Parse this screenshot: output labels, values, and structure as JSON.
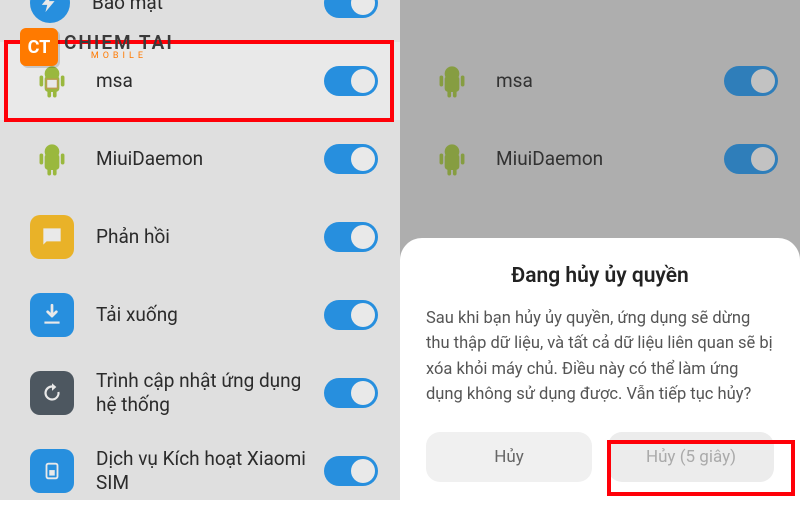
{
  "watermark": {
    "badge": "CT",
    "main": "CHIEM TAI",
    "sub": "MOBILE"
  },
  "left": {
    "rows": [
      {
        "label": "Bảo mật"
      },
      {
        "label": "msa"
      },
      {
        "label": "MiuiDaemon"
      },
      {
        "label": "Phản hồi"
      },
      {
        "label": "Tải xuống"
      },
      {
        "label": "Trình cập nhật ứng dụng hệ thống"
      },
      {
        "label": "Dịch vụ Kích hoạt Xiaomi SIM"
      }
    ]
  },
  "right": {
    "rows": [
      {
        "label": "msa"
      },
      {
        "label": "MiuiDaemon"
      }
    ]
  },
  "dialog": {
    "title": "Đang hủy ủy quyền",
    "body": "Sau khi bạn hủy ủy quyền, ứng dụng sẽ dừng thu thập dữ liệu, và tất cả dữ liệu liên quan sẽ bị xóa khỏi máy chủ. Điều này có thể làm ứng dụng không sử dụng được. Vẫn tiếp tục hủy?",
    "cancel": "Hủy",
    "confirm": "Hủy (5 giây)"
  },
  "colors": {
    "accent": "#1e97f3",
    "highlight": "#ff0008"
  }
}
